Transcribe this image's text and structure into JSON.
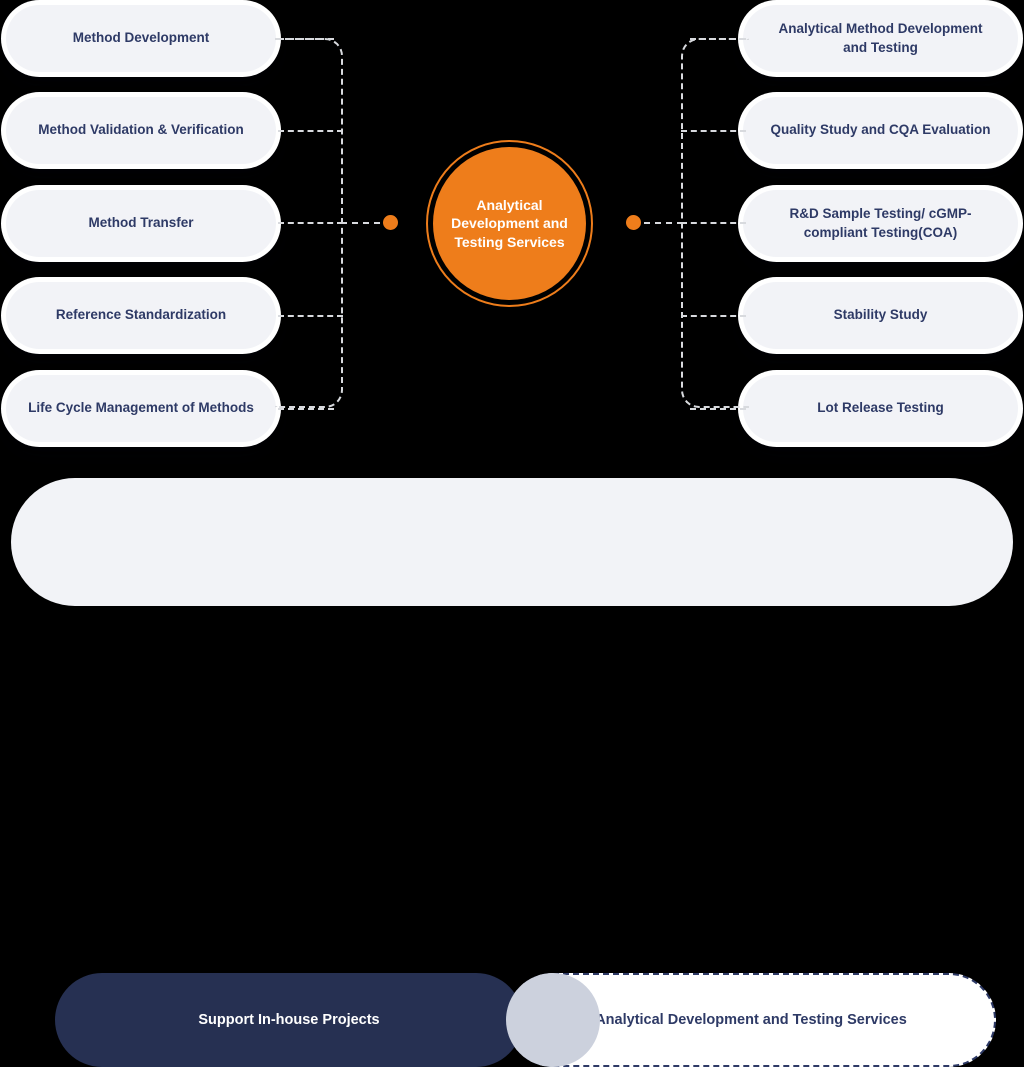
{
  "diagram": {
    "title": "Analytical Development and Testing Services",
    "center": {
      "label": "Analytical Development and Testing Services",
      "color": "#ee7d1b"
    },
    "colors": {
      "accent_orange": "#ee7d1b",
      "navy": "#263052",
      "text_navy": "#2e3a66",
      "pill_fill": "#f2f3f7",
      "connector": "#d8dade"
    },
    "left_branch": {
      "group_label": "Support In-house Projects",
      "items": [
        {
          "label": "Method Development"
        },
        {
          "label": "Method Validation & Verification"
        },
        {
          "label": "Method Transfer"
        },
        {
          "label": "Reference Standardization"
        },
        {
          "label": "Life Cycle Management of Methods"
        }
      ]
    },
    "right_branch": {
      "group_label": "Analytical Development and Testing Services",
      "items": [
        {
          "label": "Analytical Method Development and Testing"
        },
        {
          "label": "Quality Study and CQA Evaluation"
        },
        {
          "label": "R&D Sample Testing/ cGMP-compliant Testing(COA)"
        },
        {
          "label": "Stability Study"
        },
        {
          "label": "Lot Release Testing"
        }
      ]
    },
    "legend": {
      "left_label": "Support In-house Projects",
      "right_label": "Analytical Development and Testing Services"
    }
  }
}
